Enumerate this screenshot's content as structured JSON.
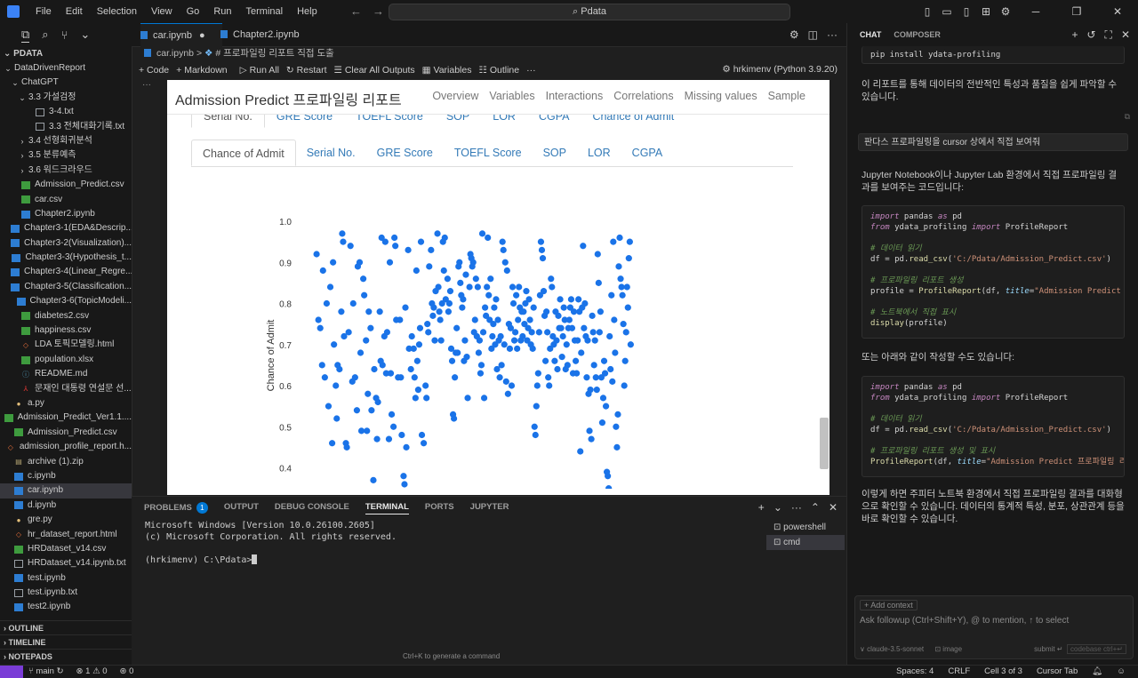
{
  "menu": [
    "File",
    "Edit",
    "Selection",
    "View",
    "Go",
    "Run",
    "Terminal",
    "Help"
  ],
  "command_center": "Pdata",
  "explorer": {
    "root": "PDATA",
    "items": [
      {
        "label": "DataDrivenReport",
        "type": "folder",
        "depth": 1,
        "twisty": "⌄"
      },
      {
        "label": "ChatGPT",
        "type": "folder",
        "depth": 2,
        "twisty": "⌄"
      },
      {
        "label": "3.3 가설검정",
        "type": "folder",
        "depth": 3,
        "twisty": "⌄"
      },
      {
        "label": "3-4.txt",
        "type": "txt",
        "depth": 4
      },
      {
        "label": "3.3 전체대화기록.txt",
        "type": "txt",
        "depth": 4
      },
      {
        "label": "3.4 선형회귀분석",
        "type": "folder",
        "depth": 3,
        "twisty": "›"
      },
      {
        "label": "3.5 분류예측",
        "type": "folder",
        "depth": 3,
        "twisty": "›"
      },
      {
        "label": "3.6 워드크라우드",
        "type": "folder",
        "depth": 3,
        "twisty": "›"
      },
      {
        "label": "Admission_Predict.csv",
        "type": "csv",
        "depth": 2
      },
      {
        "label": "car.csv",
        "type": "csv",
        "depth": 2
      },
      {
        "label": "Chapter2.ipynb",
        "type": "nb",
        "depth": 2
      },
      {
        "label": "Chapter3-1(EDA&Descrip...",
        "type": "nb",
        "depth": 2
      },
      {
        "label": "Chapter3-2(Visualization)...",
        "type": "nb",
        "depth": 2
      },
      {
        "label": "Chapter3-3(Hypothesis_t...",
        "type": "nb",
        "depth": 2
      },
      {
        "label": "Chapter3-4(Linear_Regre...",
        "type": "nb",
        "depth": 2
      },
      {
        "label": "Chapter3-5(Classification...",
        "type": "nb",
        "depth": 2
      },
      {
        "label": "Chapter3-6(TopicModeli...",
        "type": "nb",
        "depth": 2
      },
      {
        "label": "diabetes2.csv",
        "type": "csv",
        "depth": 2
      },
      {
        "label": "happiness.csv",
        "type": "csv",
        "depth": 2
      },
      {
        "label": "LDA 토픽모델링.html",
        "type": "html",
        "depth": 2
      },
      {
        "label": "population.xlsx",
        "type": "csv",
        "depth": 2
      },
      {
        "label": "README.md",
        "type": "md",
        "depth": 2
      },
      {
        "label": "문재인 대통령 연설문 선...",
        "type": "pdf",
        "depth": 2
      },
      {
        "label": "a.py",
        "type": "py",
        "depth": 1
      },
      {
        "label": "Admission_Predict_Ver1.1....",
        "type": "csv",
        "depth": 1
      },
      {
        "label": "Admission_Predict.csv",
        "type": "csv",
        "depth": 1
      },
      {
        "label": "admission_profile_report.h...",
        "type": "html",
        "depth": 1
      },
      {
        "label": "archive (1).zip",
        "type": "zip",
        "depth": 1
      },
      {
        "label": "c.ipynb",
        "type": "nb",
        "depth": 1
      },
      {
        "label": "car.ipynb",
        "type": "nb",
        "depth": 1,
        "selected": true
      },
      {
        "label": "d.ipynb",
        "type": "nb",
        "depth": 1
      },
      {
        "label": "gre.py",
        "type": "py",
        "depth": 1
      },
      {
        "label": "hr_dataset_report.html",
        "type": "html",
        "depth": 1
      },
      {
        "label": "HRDataset_v14.csv",
        "type": "csv",
        "depth": 1
      },
      {
        "label": "HRDataset_v14.ipynb.txt",
        "type": "txt",
        "depth": 1
      },
      {
        "label": "test.ipynb",
        "type": "nb",
        "depth": 1
      },
      {
        "label": "test.ipynb.txt",
        "type": "txt",
        "depth": 1
      },
      {
        "label": "test2.ipynb",
        "type": "nb",
        "depth": 1
      }
    ],
    "sections": [
      "OUTLINE",
      "TIMELINE",
      "NOTEPADS"
    ]
  },
  "tabs": [
    {
      "label": "car.ipynb",
      "modified": true
    },
    {
      "label": "Chapter2.ipynb",
      "modified": false
    }
  ],
  "breadcrumb": {
    "file": "car.ipynb",
    "sep": ">",
    "cell": "# 프로파일링 리포트 직접 도출"
  },
  "notebook_toolbar": {
    "code": "+ Code",
    "markdown": "+ Markdown",
    "run_all": "Run All",
    "restart": "Restart",
    "clear": "Clear All Outputs",
    "variables": "Variables",
    "outline": "Outline",
    "more": "···",
    "kernel": "hrkimenv (Python 3.9.20)"
  },
  "cell_gutter": "···",
  "report": {
    "title": "Admission Predict 프로파일링 리포트",
    "nav": [
      "Overview",
      "Variables",
      "Interactions",
      "Correlations",
      "Missing values",
      "Sample"
    ],
    "tabs_upper": [
      "Serial No.",
      "GRE Score",
      "TOEFL Score",
      "SOP",
      "LOR",
      "CGPA",
      "Chance of Admit"
    ],
    "tabs_lower": [
      "Chance of Admit",
      "Serial No.",
      "GRE Score",
      "TOEFL Score",
      "SOP",
      "LOR",
      "CGPA"
    ]
  },
  "chart_data": {
    "type": "scatter",
    "ylabel": "Chance of Admit",
    "xlabel": "",
    "yticks": [
      "1.0",
      "0.9",
      "0.8",
      "0.7",
      "0.6",
      "0.5",
      "0.4"
    ],
    "ylim": [
      0.36,
      1.0
    ],
    "xlim": [
      0,
      400
    ],
    "color": "#1a73e8",
    "points": [
      [
        3,
        0.92
      ],
      [
        5,
        0.76
      ],
      [
        7,
        0.74
      ],
      [
        9,
        0.65
      ],
      [
        10,
        0.88
      ],
      [
        12,
        0.62
      ],
      [
        14,
        0.8
      ],
      [
        16,
        0.55
      ],
      [
        18,
        0.84
      ],
      [
        20,
        0.46
      ],
      [
        21,
        0.9
      ],
      [
        22,
        0.7
      ],
      [
        24,
        0.6
      ],
      [
        25,
        0.52
      ],
      [
        26,
        0.65
      ],
      [
        28,
        0.64
      ],
      [
        30,
        0.78
      ],
      [
        31,
        0.97
      ],
      [
        32,
        0.95
      ],
      [
        33,
        0.72
      ],
      [
        35,
        0.46
      ],
      [
        36,
        0.45
      ],
      [
        38,
        0.73
      ],
      [
        40,
        0.94
      ],
      [
        42,
        0.61
      ],
      [
        43,
        0.8
      ],
      [
        45,
        0.62
      ],
      [
        47,
        0.54
      ],
      [
        48,
        0.89
      ],
      [
        50,
        0.9
      ],
      [
        51,
        0.68
      ],
      [
        52,
        0.49
      ],
      [
        54,
        0.86
      ],
      [
        55,
        0.82
      ],
      [
        57,
        0.71
      ],
      [
        58,
        0.49
      ],
      [
        59,
        0.58
      ],
      [
        60,
        0.78
      ],
      [
        62,
        0.74
      ],
      [
        63,
        0.54
      ],
      [
        65,
        0.37
      ],
      [
        66,
        0.64
      ],
      [
        68,
        0.57
      ],
      [
        69,
        0.47
      ],
      [
        70,
        0.56
      ],
      [
        72,
        0.78
      ],
      [
        73,
        0.66
      ],
      [
        74,
        0.96
      ],
      [
        75,
        0.65
      ],
      [
        77,
        0.72
      ],
      [
        78,
        0.95
      ],
      [
        79,
        0.63
      ],
      [
        80,
        0.73
      ],
      [
        82,
        0.47
      ],
      [
        83,
        0.9
      ],
      [
        84,
        0.63
      ],
      [
        85,
        0.53
      ],
      [
        87,
        0.5
      ],
      [
        88,
        0.96
      ],
      [
        89,
        0.94
      ],
      [
        90,
        0.76
      ],
      [
        92,
        0.62
      ],
      [
        94,
        0.76
      ],
      [
        95,
        0.62
      ],
      [
        96,
        0.48
      ],
      [
        98,
        0.38
      ],
      [
        99,
        0.36
      ],
      [
        100,
        0.79
      ],
      [
        101,
        0.45
      ],
      [
        103,
        0.93
      ],
      [
        104,
        0.69
      ],
      [
        106,
        0.64
      ],
      [
        107,
        0.72
      ],
      [
        109,
        0.69
      ],
      [
        110,
        0.62
      ],
      [
        111,
        0.57
      ],
      [
        112,
        0.88
      ],
      [
        113,
        0.66
      ],
      [
        114,
        0.59
      ],
      [
        115,
        0.7
      ],
      [
        116,
        0.74
      ],
      [
        117,
        0.95
      ],
      [
        118,
        0.48
      ],
      [
        120,
        0.46
      ],
      [
        122,
        0.6
      ],
      [
        123,
        0.57
      ],
      [
        124,
        0.75
      ],
      [
        125,
        0.73
      ],
      [
        126,
        0.89
      ],
      [
        128,
        0.93
      ],
      [
        129,
        0.8
      ],
      [
        130,
        0.77
      ],
      [
        131,
        0.79
      ],
      [
        132,
        0.71
      ],
      [
        133,
        0.83
      ],
      [
        135,
        0.97
      ],
      [
        136,
        0.84
      ],
      [
        137,
        0.78
      ],
      [
        138,
        0.76
      ],
      [
        139,
        0.71
      ],
      [
        140,
        0.8
      ],
      [
        141,
        0.95
      ],
      [
        142,
        0.88
      ],
      [
        143,
        0.96
      ],
      [
        144,
        0.81
      ],
      [
        146,
        0.86
      ],
      [
        147,
        0.78
      ],
      [
        148,
        0.8
      ],
      [
        149,
        0.83
      ],
      [
        150,
        0.69
      ],
      [
        151,
        0.66
      ],
      [
        152,
        0.53
      ],
      [
        153,
        0.52
      ],
      [
        154,
        0.62
      ],
      [
        155,
        0.68
      ],
      [
        156,
        0.74
      ],
      [
        157,
        0.68
      ],
      [
        158,
        0.89
      ],
      [
        159,
        0.9
      ],
      [
        160,
        0.85
      ],
      [
        161,
        0.82
      ],
      [
        162,
        0.79
      ],
      [
        163,
        0.81
      ],
      [
        164,
        0.66
      ],
      [
        165,
        0.71
      ],
      [
        166,
        0.87
      ],
      [
        167,
        0.67
      ],
      [
        168,
        0.57
      ],
      [
        170,
        0.84
      ],
      [
        171,
        0.92
      ],
      [
        172,
        0.91
      ],
      [
        173,
        0.89
      ],
      [
        174,
        0.9
      ],
      [
        175,
        0.73
      ],
      [
        176,
        0.76
      ],
      [
        177,
        0.86
      ],
      [
        178,
        0.72
      ],
      [
        179,
        0.84
      ],
      [
        180,
        0.68
      ],
      [
        181,
        0.71
      ],
      [
        182,
        0.63
      ],
      [
        183,
        0.65
      ],
      [
        184,
        0.97
      ],
      [
        185,
        0.73
      ],
      [
        186,
        0.57
      ],
      [
        187,
        0.79
      ],
      [
        188,
        0.77
      ],
      [
        189,
        0.84
      ],
      [
        190,
        0.96
      ],
      [
        191,
        0.82
      ],
      [
        192,
        0.76
      ],
      [
        193,
        0.86
      ],
      [
        194,
        0.69
      ],
      [
        195,
        0.72
      ],
      [
        196,
        0.75
      ],
      [
        197,
        0.79
      ],
      [
        198,
        0.7
      ],
      [
        199,
        0.81
      ],
      [
        200,
        0.64
      ],
      [
        201,
        0.76
      ],
      [
        202,
        0.71
      ],
      [
        203,
        0.62
      ],
      [
        204,
        0.72
      ],
      [
        205,
        0.65
      ],
      [
        206,
        0.95
      ],
      [
        207,
        0.93
      ],
      [
        208,
        0.7
      ],
      [
        209,
        0.9
      ],
      [
        210,
        0.61
      ],
      [
        211,
        0.88
      ],
      [
        212,
        0.58
      ],
      [
        213,
        0.75
      ],
      [
        214,
        0.69
      ],
      [
        215,
        0.74
      ],
      [
        216,
        0.6
      ],
      [
        217,
        0.84
      ],
      [
        218,
        0.8
      ],
      [
        219,
        0.71
      ],
      [
        220,
        0.73
      ],
      [
        221,
        0.82
      ],
      [
        222,
        0.69
      ],
      [
        223,
        0.76
      ],
      [
        224,
        0.84
      ],
      [
        225,
        0.79
      ],
      [
        226,
        0.71
      ],
      [
        227,
        0.78
      ],
      [
        228,
        0.72
      ],
      [
        229,
        0.78
      ],
      [
        230,
        0.75
      ],
      [
        231,
        0.8
      ],
      [
        232,
        0.83
      ],
      [
        233,
        0.71
      ],
      [
        234,
        0.74
      ],
      [
        235,
        0.81
      ],
      [
        236,
        0.76
      ],
      [
        237,
        0.7
      ],
      [
        238,
        0.73
      ],
      [
        239,
        0.69
      ],
      [
        240,
        0.79
      ],
      [
        241,
        0.5
      ],
      [
        242,
        0.48
      ],
      [
        243,
        0.55
      ],
      [
        244,
        0.6
      ],
      [
        245,
        0.63
      ],
      [
        246,
        0.73
      ],
      [
        247,
        0.82
      ],
      [
        248,
        0.95
      ],
      [
        249,
        0.93
      ],
      [
        250,
        0.91
      ],
      [
        251,
        0.83
      ],
      [
        252,
        0.77
      ],
      [
        253,
        0.66
      ],
      [
        254,
        0.78
      ],
      [
        255,
        0.73
      ],
      [
        256,
        0.62
      ],
      [
        257,
        0.6
      ],
      [
        258,
        0.69
      ],
      [
        259,
        0.86
      ],
      [
        260,
        0.84
      ],
      [
        261,
        0.72
      ],
      [
        262,
        0.7
      ],
      [
        263,
        0.66
      ],
      [
        264,
        0.78
      ],
      [
        265,
        0.71
      ],
      [
        266,
        0.64
      ],
      [
        267,
        0.77
      ],
      [
        268,
        0.74
      ],
      [
        269,
        0.81
      ],
      [
        270,
        0.74
      ],
      [
        271,
        0.67
      ],
      [
        272,
        0.72
      ],
      [
        273,
        0.79
      ],
      [
        274,
        0.76
      ],
      [
        275,
        0.64
      ],
      [
        276,
        0.7
      ],
      [
        277,
        0.65
      ],
      [
        278,
        0.74
      ],
      [
        279,
        0.76
      ],
      [
        280,
        0.79
      ],
      [
        281,
        0.81
      ],
      [
        282,
        0.74
      ],
      [
        283,
        0.63
      ],
      [
        284,
        0.78
      ],
      [
        285,
        0.71
      ],
      [
        286,
        0.66
      ],
      [
        287,
        0.63
      ],
      [
        288,
        0.71
      ],
      [
        289,
        0.81
      ],
      [
        290,
        0.78
      ],
      [
        291,
        0.44
      ],
      [
        292,
        0.68
      ],
      [
        293,
        0.79
      ],
      [
        294,
        0.94
      ],
      [
        295,
        0.74
      ],
      [
        296,
        0.8
      ],
      [
        297,
        0.72
      ],
      [
        298,
        0.62
      ],
      [
        299,
        0.71
      ],
      [
        300,
        0.58
      ],
      [
        301,
        0.49
      ],
      [
        302,
        0.59
      ],
      [
        303,
        0.47
      ],
      [
        304,
        0.77
      ],
      [
        305,
        0.73
      ],
      [
        306,
        0.65
      ],
      [
        307,
        0.71
      ],
      [
        308,
        0.62
      ],
      [
        309,
        0.59
      ],
      [
        310,
        0.92
      ],
      [
        311,
        0.85
      ],
      [
        312,
        0.73
      ],
      [
        313,
        0.78
      ],
      [
        314,
        0.62
      ],
      [
        315,
        0.51
      ],
      [
        316,
        0.57
      ],
      [
        317,
        0.66
      ],
      [
        318,
        0.63
      ],
      [
        319,
        0.55
      ],
      [
        320,
        0.39
      ],
      [
        321,
        0.38
      ],
      [
        322,
        0.35
      ],
      [
        323,
        0.72
      ],
      [
        324,
        0.64
      ],
      [
        325,
        0.82
      ],
      [
        326,
        0.61
      ],
      [
        327,
        0.95
      ],
      [
        328,
        0.76
      ],
      [
        329,
        0.68
      ],
      [
        330,
        0.5
      ],
      [
        331,
        0.45
      ],
      [
        332,
        0.53
      ],
      [
        333,
        0.89
      ],
      [
        334,
        0.96
      ],
      [
        335,
        0.86
      ],
      [
        336,
        0.84
      ],
      [
        337,
        0.82
      ],
      [
        338,
        0.75
      ],
      [
        339,
        0.6
      ],
      [
        340,
        0.66
      ],
      [
        341,
        0.73
      ],
      [
        342,
        0.84
      ],
      [
        343,
        0.79
      ],
      [
        344,
        0.91
      ],
      [
        345,
        0.95
      ],
      [
        346,
        0.7
      ]
    ]
  },
  "panel": {
    "tabs": [
      "PROBLEMS",
      "OUTPUT",
      "DEBUG CONSOLE",
      "TERMINAL",
      "PORTS",
      "JUPYTER"
    ],
    "problems_count": "1",
    "terminal_lines": [
      "Microsoft Windows [Version 10.0.26100.2605]",
      "(c) Microsoft Corporation. All rights reserved.",
      "",
      "(hrkimenv) C:\\Pdata>"
    ],
    "terminals": [
      "powershell",
      "cmd"
    ],
    "gen_hint": "Ctrl+K to generate a command"
  },
  "chat": {
    "tabs": [
      "CHAT",
      "COMPOSER"
    ],
    "top_code": "pip install ydata-profiling",
    "para1": "이 리포트를 통해 데이터의 전반적인 특성과 품질을 쉽게 파악할 수 있습니다.",
    "user_query": "판다스 프로파일링을 cursor 상에서 직접 보여줘",
    "para2": "Jupyter Notebook이나 Jupyter Lab 환경에서 직접 프로파일링 결과를 보여주는 코드입니다:",
    "para3": "또는 아래와 같이 작성할 수도 있습니다:",
    "para4": "이렇게 하면 주피터 노트북 환경에서 직접 프로파일링 결과를 대화형으로 확인할 수 있습니다. 데이터의 통계적 특성, 분포, 상관관계 등을 바로 확인할 수 있습니다.",
    "add_context": "+ Add context",
    "placeholder": "Ask followup (Ctrl+Shift+Y), @ to mention, ↑ to select",
    "model": "∨ claude-3.5-sonnet",
    "image": "⊡ image",
    "submit": "submit ↵",
    "codebase": "codebase ctrl+↵"
  },
  "statusbar": {
    "branch": "main",
    "errors": "1",
    "warnings": "0",
    "ports": "0",
    "spaces": "Spaces: 4",
    "eol": "CRLF",
    "cell": "Cell 3 of 3",
    "cursor_tab": "Cursor Tab"
  }
}
